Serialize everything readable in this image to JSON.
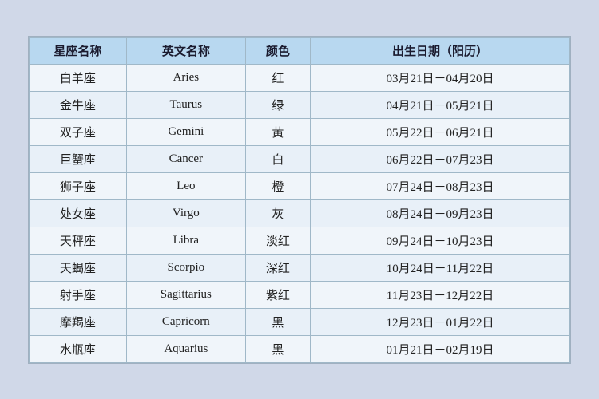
{
  "table": {
    "headers": {
      "chinese_name": "星座名称",
      "english_name": "英文名称",
      "color": "颜色",
      "birth_date": "出生日期（阳历）"
    },
    "rows": [
      {
        "chinese": "白羊座",
        "english": "Aries",
        "color": "红",
        "date": "03月21日－04月20日"
      },
      {
        "chinese": "金牛座",
        "english": "Taurus",
        "color": "绿",
        "date": "04月21日－05月21日"
      },
      {
        "chinese": "双子座",
        "english": "Gemini",
        "color": "黄",
        "date": "05月22日－06月21日"
      },
      {
        "chinese": "巨蟹座",
        "english": "Cancer",
        "color": "白",
        "date": "06月22日－07月23日"
      },
      {
        "chinese": "狮子座",
        "english": "Leo",
        "color": "橙",
        "date": "07月24日－08月23日"
      },
      {
        "chinese": "处女座",
        "english": "Virgo",
        "color": "灰",
        "date": "08月24日－09月23日"
      },
      {
        "chinese": "天秤座",
        "english": "Libra",
        "color": "淡红",
        "date": "09月24日－10月23日"
      },
      {
        "chinese": "天蝎座",
        "english": "Scorpio",
        "color": "深红",
        "date": "10月24日－11月22日"
      },
      {
        "chinese": "射手座",
        "english": "Sagittarius",
        "color": "紫红",
        "date": "11月23日－12月22日"
      },
      {
        "chinese": "摩羯座",
        "english": "Capricorn",
        "color": "黑",
        "date": "12月23日－01月22日"
      },
      {
        "chinese": "水瓶座",
        "english": "Aquarius",
        "color": "黑",
        "date": "01月21日－02月19日"
      }
    ]
  }
}
